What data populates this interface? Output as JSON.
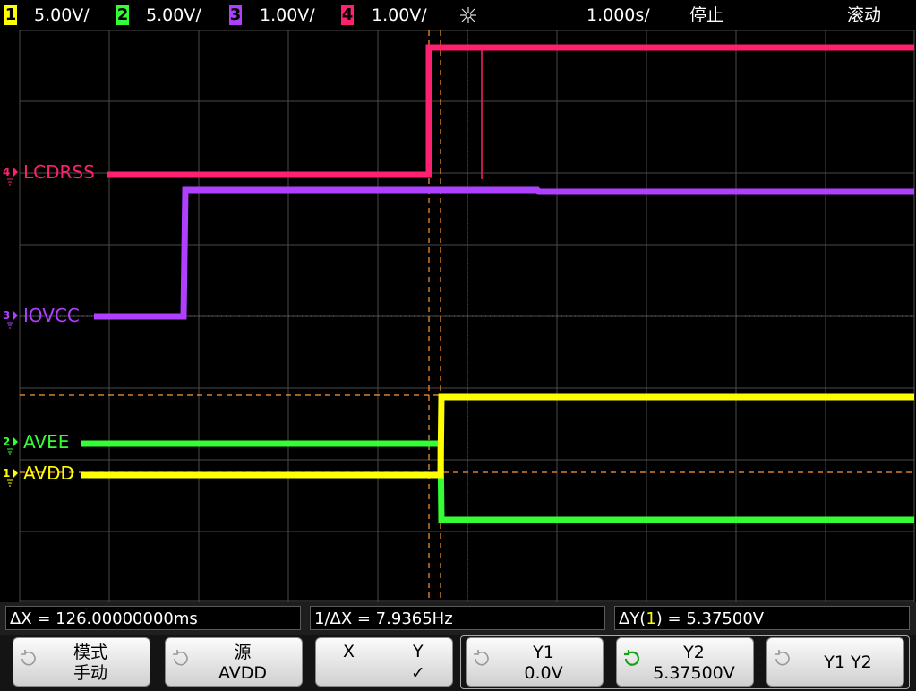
{
  "topbar": {
    "channels": [
      {
        "num": "1",
        "scale": "5.00V/",
        "color": "#ffff00"
      },
      {
        "num": "2",
        "scale": "5.00V/",
        "color": "#33ff33"
      },
      {
        "num": "3",
        "scale": "1.00V/",
        "color": "#b040ff"
      },
      {
        "num": "4",
        "scale": "1.00V/",
        "color": "#ff2070"
      }
    ],
    "trigger_icon": "trigger-asterisk-icon",
    "timebase": "1.000s/",
    "run_state": "停止",
    "mode": "滚动"
  },
  "traces": {
    "lcdrss": {
      "label": "LCDRSS",
      "marker": "4",
      "color": "#ff2070"
    },
    "iovcc": {
      "label": "IOVCC",
      "marker": "3",
      "color": "#b040ff"
    },
    "avee": {
      "label": "AVEE",
      "marker": "2",
      "color": "#33ff33"
    },
    "avdd": {
      "label": "AVDD",
      "marker": "1",
      "color": "#ffff00"
    }
  },
  "cursor_color": "#ff9933",
  "measurements": {
    "delta_x": "ΔX = 126.00000000ms",
    "inv_delta_x": "1/ΔX = 7.9365Hz",
    "delta_y_prefix": "ΔY(",
    "delta_y_ch": "1",
    "delta_y_suffix": ") = 5.37500V"
  },
  "softkeys": {
    "mode": {
      "line1": "模式",
      "line2": "手动"
    },
    "source": {
      "line1": "源",
      "line2": "AVDD"
    },
    "xy": {
      "x": "X",
      "y": "Y",
      "check": "✓"
    },
    "y1": {
      "line1": "Y1",
      "line2": "0.0V"
    },
    "y2": {
      "line1": "Y2",
      "line2": "5.37500V"
    },
    "y1y2": {
      "line1": "Y1 Y2"
    }
  }
}
